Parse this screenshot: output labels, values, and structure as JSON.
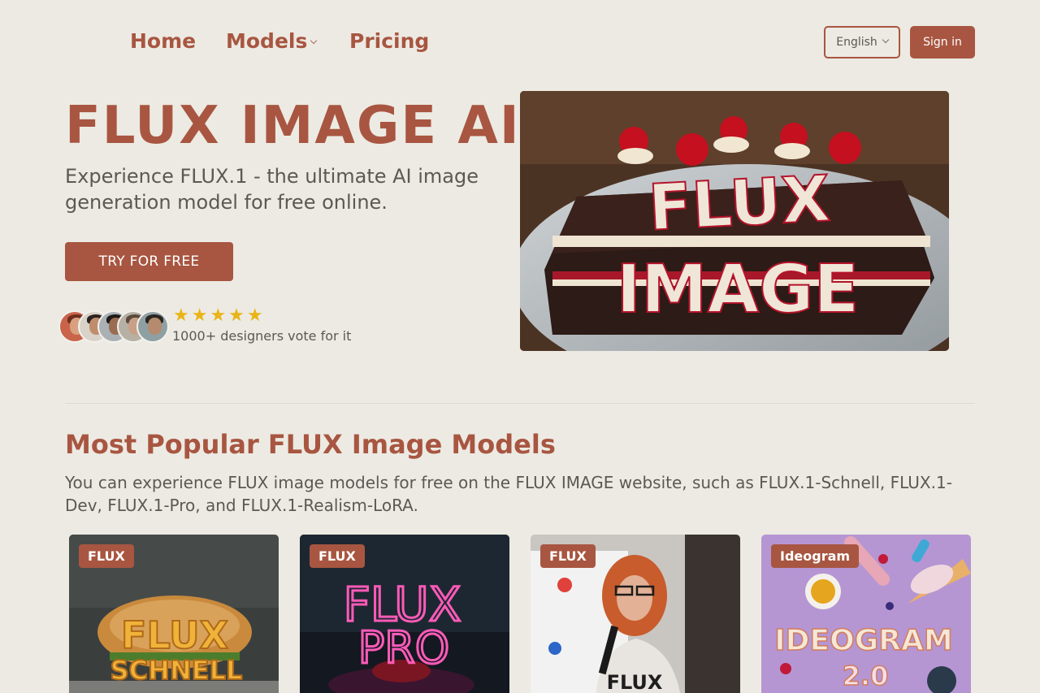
{
  "nav": {
    "items": [
      {
        "label": "Home"
      },
      {
        "label": "Models"
      },
      {
        "label": "Pricing"
      }
    ],
    "language": "English",
    "signin": "Sign in"
  },
  "hero": {
    "title": "FLUX IMAGE AI",
    "subtitle": "Experience FLUX.1 - the ultimate AI image generation model for free online.",
    "cta": "TRY FOR FREE",
    "rating_stars": 5,
    "stars_text": "★★★★★",
    "vote_text": "1000+ designers vote for it",
    "image_text": [
      "FLUX",
      "IMAGE"
    ]
  },
  "models_section": {
    "title": "Most Popular FLUX Image Models",
    "description": "You can experience FLUX image models for free on the FLUX IMAGE website, such as FLUX.1-Schnell, FLUX.1-Dev, FLUX.1-Pro, and FLUX.1-Realism-LoRA.",
    "cards": [
      {
        "badge": "FLUX",
        "image_text": [
          "FLUX",
          "SCHNELL"
        ]
      },
      {
        "badge": "FLUX",
        "image_text": [
          "FLUX",
          "PRO"
        ]
      },
      {
        "badge": "FLUX",
        "image_text": [
          "FLUX"
        ]
      },
      {
        "badge": "Ideogram",
        "image_text": [
          "IDEOGRAM",
          "2.0"
        ]
      }
    ]
  },
  "colors": {
    "accent": "#a85641",
    "background": "#eceae3",
    "star": "#e9b418"
  }
}
